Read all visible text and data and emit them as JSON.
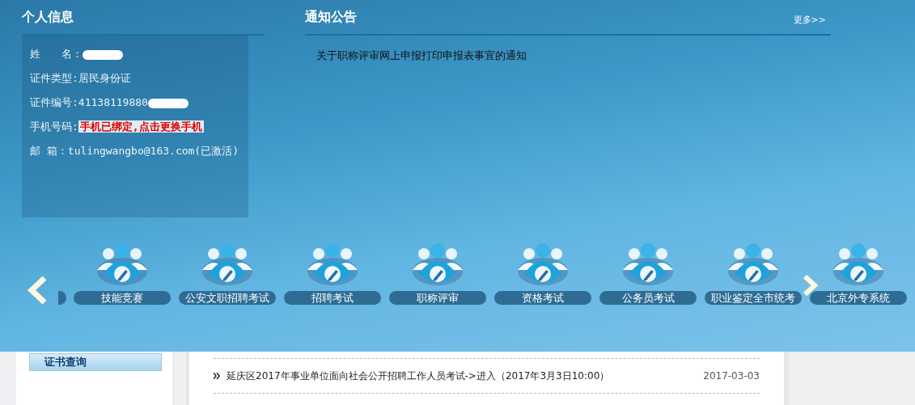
{
  "profile": {
    "title": "个人信息",
    "fields": [
      {
        "kind": "redacted",
        "label": "姓　　名："
      },
      {
        "kind": "text",
        "label": "证件类型:",
        "value": "居民身份证"
      },
      {
        "kind": "redacted",
        "label": "证件编号:",
        "value": "41138119880"
      },
      {
        "kind": "alert",
        "label": "手机号码:",
        "value": "手机已绑定,点击更换手机"
      },
      {
        "kind": "text",
        "label": "邮 箱：",
        "value": "tulingwangbo@163.com(已激活)"
      }
    ]
  },
  "notices": {
    "title": "通知公告",
    "more": "更多>>",
    "items": [
      "关于职称评审网上申报打印申报表事宜的通知"
    ]
  },
  "shortcuts": [
    "技能竞赛",
    "公安文职招聘考试",
    "招聘考试",
    "职称评审",
    "资格考试",
    "公务员考试",
    "职业鉴定全市统考",
    "北京外专系统"
  ],
  "sidebar": {
    "items": [
      "证书查询"
    ]
  },
  "news": [
    {
      "title": "延庆区2017年事业单位面向社会公开招聘工作人员考试->进入（2017年3月3日10:00）",
      "date": "2017-03-03"
    }
  ]
}
